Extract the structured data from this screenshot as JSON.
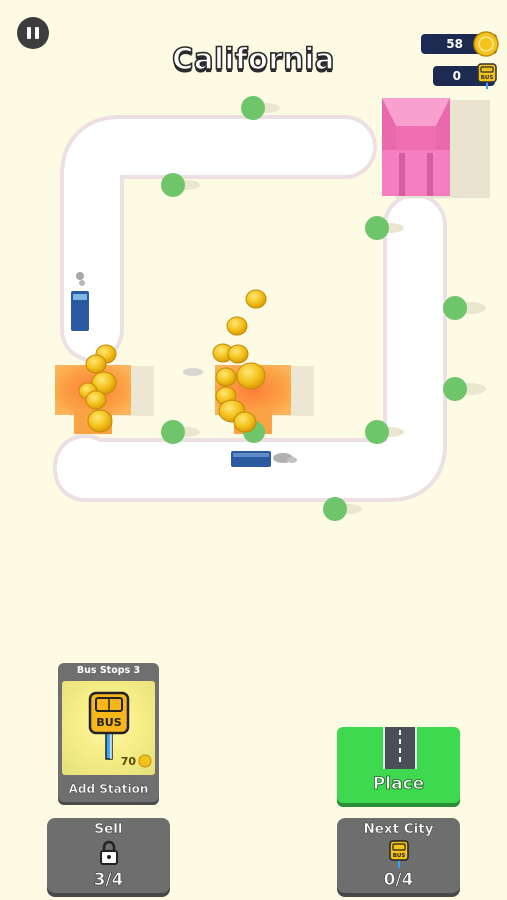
{
  "header": {
    "city_name": "California",
    "coins": "58",
    "buses": "0"
  },
  "cards": {
    "bus_stops": {
      "title": "Bus Stops 3",
      "sign_text": "BUS",
      "price": "70",
      "label": "Add Station"
    }
  },
  "buttons": {
    "place_label": "Place",
    "sell_title": "Sell",
    "sell_value": "3/4",
    "next_city_title": "Next City",
    "next_city_value": "0/4",
    "next_city_sign": "BUS"
  },
  "counter_sign": "BUS",
  "colors": {
    "background": "#fdfbe4",
    "road": "#ffffff",
    "road_edge": "#efe2e6",
    "tree": "#6fc56a",
    "depot": "#f57ec0",
    "station": "#f9a344",
    "bus": "#2c5aa0",
    "coin": "#f3c21b",
    "place_green": "#3fd94f",
    "counter_navy": "#1d2b52"
  }
}
